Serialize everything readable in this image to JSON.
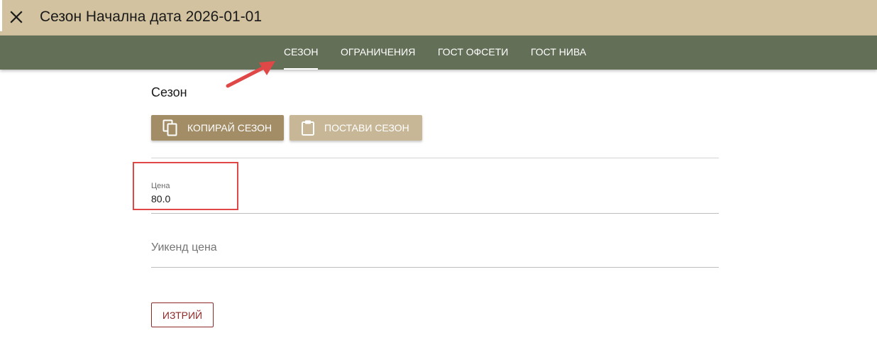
{
  "header": {
    "title": "Сезон Начална дата 2026-01-01",
    "close_icon": "close-icon"
  },
  "tabs": [
    {
      "label": "СЕЗОН",
      "active": true
    },
    {
      "label": "ОГРАНИЧЕНИЯ",
      "active": false
    },
    {
      "label": "ГОСТ ОФСЕТИ",
      "active": false
    },
    {
      "label": "ГОСТ НИВА",
      "active": false
    }
  ],
  "section": {
    "title": "Сезон"
  },
  "actions": {
    "copy_label": "КОПИРАЙ СЕЗОН",
    "copy_icon": "copy-icon",
    "paste_label": "ПОСТАВИ СЕЗОН",
    "paste_icon": "clipboard-icon"
  },
  "fields": {
    "price": {
      "label": "Цена",
      "value": "80.0"
    },
    "weekend_price": {
      "label": "Уикенд цена",
      "value": ""
    }
  },
  "delete_label": "ИЗТРИЙ",
  "colors": {
    "header_bg": "#d2c29f",
    "tabbar_bg": "#636f57",
    "copy_button_bg": "#a38d66",
    "paste_button_bg": "#c7b797",
    "delete_accent": "#8c2a2a",
    "annotation_red": "#e04848"
  }
}
